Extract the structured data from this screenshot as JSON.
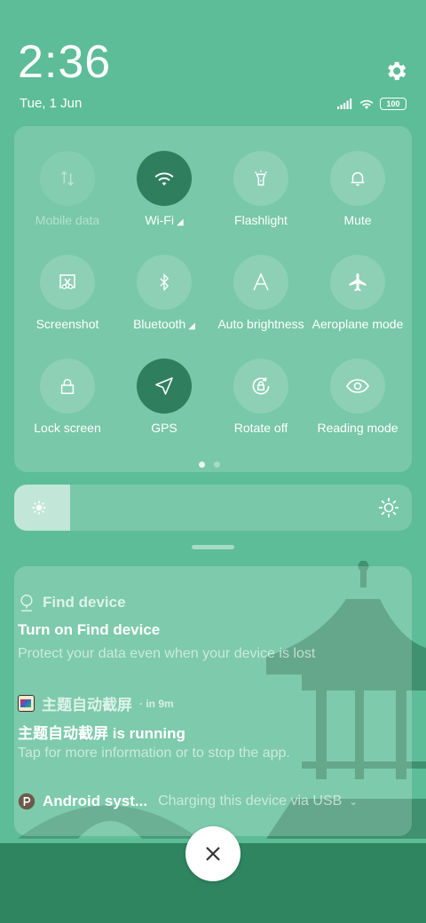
{
  "status_bar": {
    "time": "2:36",
    "date": "Tue, 1 Jun",
    "battery": "100",
    "icons": [
      "signal-icon",
      "wifi-icon",
      "battery-icon"
    ]
  },
  "settings_icon": "gear-icon",
  "quick_settings": {
    "tiles": [
      {
        "label": "Mobile data",
        "icon": "mobile-data-icon",
        "state": "disabled"
      },
      {
        "label": "Wi-Fi",
        "icon": "wifi-icon",
        "state": "active",
        "has_caret": true
      },
      {
        "label": "Flashlight",
        "icon": "flashlight-icon",
        "state": "off"
      },
      {
        "label": "Mute",
        "icon": "bell-icon",
        "state": "off"
      },
      {
        "label": "Screenshot",
        "icon": "screenshot-icon",
        "state": "off"
      },
      {
        "label": "Bluetooth",
        "icon": "bluetooth-icon",
        "state": "off",
        "has_caret": true
      },
      {
        "label": "Auto brightness",
        "icon": "auto-brightness-icon",
        "state": "off"
      },
      {
        "label": "Aeroplane mode",
        "icon": "airplane-icon",
        "state": "off"
      },
      {
        "label": "Lock screen",
        "icon": "lock-icon",
        "state": "off"
      },
      {
        "label": "GPS",
        "icon": "location-arrow-icon",
        "state": "active"
      },
      {
        "label": "Rotate off",
        "icon": "rotate-lock-icon",
        "state": "off"
      },
      {
        "label": "Reading mode",
        "icon": "eye-icon",
        "state": "off"
      }
    ],
    "page_count": 2,
    "current_page": 1
  },
  "brightness": {
    "level": 0.14
  },
  "notifications": [
    {
      "app": "Find device",
      "icon": "location-pin-icon",
      "title": "Turn on Find device",
      "body": "Protect your data even when your device is lost"
    },
    {
      "app": "主题自动截屏",
      "time": "· in 9m",
      "icon": "app-icon",
      "title": "主题自动截屏 is running",
      "body": "Tap for more information or to stop the app."
    },
    {
      "app": "Android syst...",
      "icon": "android-system-icon",
      "summary": "Charging this device via USB"
    }
  ],
  "close_icon": "close-icon",
  "colors": {
    "background": "#5dbd98",
    "active_tile": "#2f7f5f",
    "bottom_bar": "#2f8560"
  }
}
